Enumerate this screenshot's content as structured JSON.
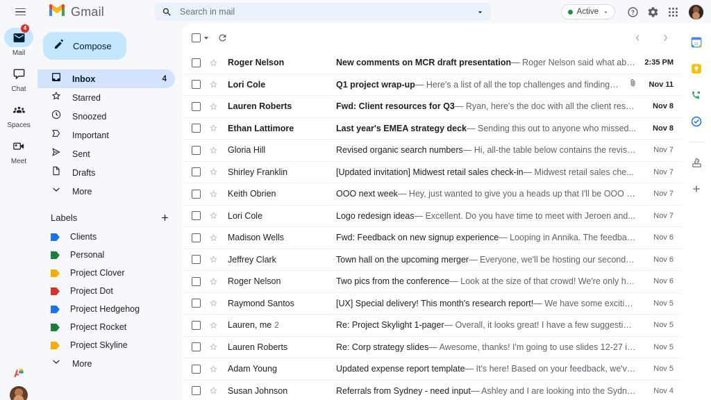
{
  "header": {
    "menu_icon": "hamburger-icon",
    "logo_icon": "gmail-logo-icon",
    "brand": "Gmail",
    "search": {
      "icon": "search-icon",
      "placeholder": "Search in mail",
      "value": "",
      "options_icon": "search-options-chevron-icon"
    },
    "status": {
      "label": "Active",
      "dot_color": "#1e8e3e",
      "chevron_icon": "chevron-down-icon"
    },
    "help_icon": "help-circle-icon",
    "settings_icon": "gear-icon",
    "apps_icon": "apps-grid-icon",
    "avatar_icon": "user-avatar"
  },
  "rail": {
    "items": [
      {
        "label": "Mail",
        "icon": "mail-icon",
        "badge": "4",
        "active": true
      },
      {
        "label": "Chat",
        "icon": "chat-icon",
        "badge": "",
        "active": false
      },
      {
        "label": "Spaces",
        "icon": "spaces-icon",
        "badge": "",
        "active": false
      },
      {
        "label": "Meet",
        "icon": "meet-icon",
        "badge": "",
        "active": false
      }
    ]
  },
  "sidebar": {
    "compose": {
      "label": "Compose",
      "icon": "pencil-icon"
    },
    "nav": [
      {
        "label": "Inbox",
        "icon": "inbox-icon",
        "count": "4",
        "active": true
      },
      {
        "label": "Starred",
        "icon": "star-icon",
        "count": "",
        "active": false
      },
      {
        "label": "Snoozed",
        "icon": "clock-icon",
        "count": "",
        "active": false
      },
      {
        "label": "Important",
        "icon": "important-icon",
        "count": "",
        "active": false
      },
      {
        "label": "Sent",
        "icon": "send-icon",
        "count": "",
        "active": false
      },
      {
        "label": "Drafts",
        "icon": "draft-icon",
        "count": "",
        "active": false
      },
      {
        "label": "More",
        "icon": "chevron-down-icon",
        "count": "",
        "active": false
      }
    ],
    "labels_title": "Labels",
    "labels_add_icon": "plus-icon",
    "labels": [
      {
        "label": "Clients",
        "color": "#1a73e8"
      },
      {
        "label": "Personal",
        "color": "#188038"
      },
      {
        "label": "Project Clover",
        "color": "#f9ab00"
      },
      {
        "label": "Project Dot",
        "color": "#d93025"
      },
      {
        "label": "Project Hedgehog",
        "color": "#1a73e8"
      },
      {
        "label": "Project Rocket",
        "color": "#188038"
      },
      {
        "label": "Project Skyline",
        "color": "#f9ab00"
      }
    ],
    "labels_more": {
      "label": "More",
      "icon": "chevron-down-icon"
    },
    "bottom": {
      "contact_icon": "contacts-avatar-icon",
      "avatar_icon": "user-avatar-small"
    }
  },
  "toolbar": {
    "select_all_icon": "checkbox-icon",
    "select_all_caret_icon": "chevron-down-icon",
    "refresh_icon": "refresh-icon",
    "prev_icon": "chevron-left-icon",
    "next_icon": "chevron-right-icon"
  },
  "emails": [
    {
      "sender": "Roger Nelson",
      "threads": "",
      "subject": "New comments on MCR draft presentation",
      "snippet": "Roger Nelson said what abou...",
      "date": "2:35 PM",
      "unread": true,
      "attachment": false
    },
    {
      "sender": "Lori Cole",
      "threads": "",
      "subject": "Q1 project wrap-up",
      "snippet": "Here's a list of all the top challenges and findings. Sur...",
      "date": "Nov 11",
      "unread": true,
      "attachment": true
    },
    {
      "sender": "Lauren Roberts",
      "threads": "",
      "subject": "Fwd: Client resources for Q3",
      "snippet": "Ryan, here's the doc with all the client resou...",
      "date": "Nov 8",
      "unread": true,
      "attachment": false
    },
    {
      "sender": "Ethan Lattimore",
      "threads": "",
      "subject": "Last year's EMEA strategy deck",
      "snippet": "Sending this out to anyone who missed...",
      "date": "Nov 8",
      "unread": true,
      "attachment": false
    },
    {
      "sender": "Gloria Hill",
      "threads": "",
      "subject": "Revised organic search numbers",
      "snippet": "Hi, all-the table below contains the revise...",
      "date": "Nov 7",
      "unread": false,
      "attachment": false
    },
    {
      "sender": "Shirley Franklin",
      "threads": "",
      "subject": "[Updated invitation] Midwest retail sales check-in",
      "snippet": "Midwest retail sales che...",
      "date": "Nov 7",
      "unread": false,
      "attachment": false
    },
    {
      "sender": "Keith Obrien",
      "threads": "",
      "subject": "OOO next week",
      "snippet": "Hey, just wanted to give you a heads up that I'll be OOO ne...",
      "date": "Nov 7",
      "unread": false,
      "attachment": false
    },
    {
      "sender": "Lori Cole",
      "threads": "",
      "subject": "Logo redesign ideas",
      "snippet": "Excellent. Do you have time to meet with Jeroen and...",
      "date": "Nov 7",
      "unread": false,
      "attachment": false
    },
    {
      "sender": "Madison Wells",
      "threads": "",
      "subject": "Fwd: Feedback on new signup experience",
      "snippet": "Looping in Annika. The feedback...",
      "date": "Nov 6",
      "unread": false,
      "attachment": false
    },
    {
      "sender": "Jeffrey Clark",
      "threads": "",
      "subject": "Town hall on the upcoming merger",
      "snippet": "Everyone, we'll be hosting our second t...",
      "date": "Nov 6",
      "unread": false,
      "attachment": false
    },
    {
      "sender": "Roger Nelson",
      "threads": "",
      "subject": "Two pics from the conference",
      "snippet": "Look at the size of that crowd! We're only ha...",
      "date": "Nov 6",
      "unread": false,
      "attachment": false
    },
    {
      "sender": "Raymond Santos",
      "threads": "",
      "subject": "[UX] Special delivery! This month's research report!",
      "snippet": "We have some exciting...",
      "date": "Nov 5",
      "unread": false,
      "attachment": false
    },
    {
      "sender": "Lauren, me",
      "threads": "2",
      "subject": "Re: Project Skylight 1-pager",
      "snippet": "Overall, it looks great! I have a few suggestions...",
      "date": "Nov 5",
      "unread": false,
      "attachment": false
    },
    {
      "sender": "Lauren Roberts",
      "threads": "",
      "subject": "Re: Corp strategy slides",
      "snippet": "Awesome, thanks! I'm going to use slides 12-27 in...",
      "date": "Nov 5",
      "unread": false,
      "attachment": false
    },
    {
      "sender": "Adam Young",
      "threads": "",
      "subject": "Updated expense report template",
      "snippet": "It's here! Based on your feedback, we've...",
      "date": "Nov 5",
      "unread": false,
      "attachment": false
    },
    {
      "sender": "Susan Johnson",
      "threads": "",
      "subject": "Referrals from Sydney - need input",
      "snippet": "Ashley and I are looking into the Sydney",
      "date": "Nov 4",
      "unread": false,
      "attachment": false
    }
  ],
  "rightpanel": {
    "items": [
      {
        "icon": "google-calendar-icon"
      },
      {
        "icon": "google-keep-icon"
      },
      {
        "icon": "google-contacts-phone-icon"
      },
      {
        "icon": "google-tasks-icon"
      }
    ],
    "addon_icon": "puzzle-addon-icon",
    "add_icon": "plus-icon"
  }
}
